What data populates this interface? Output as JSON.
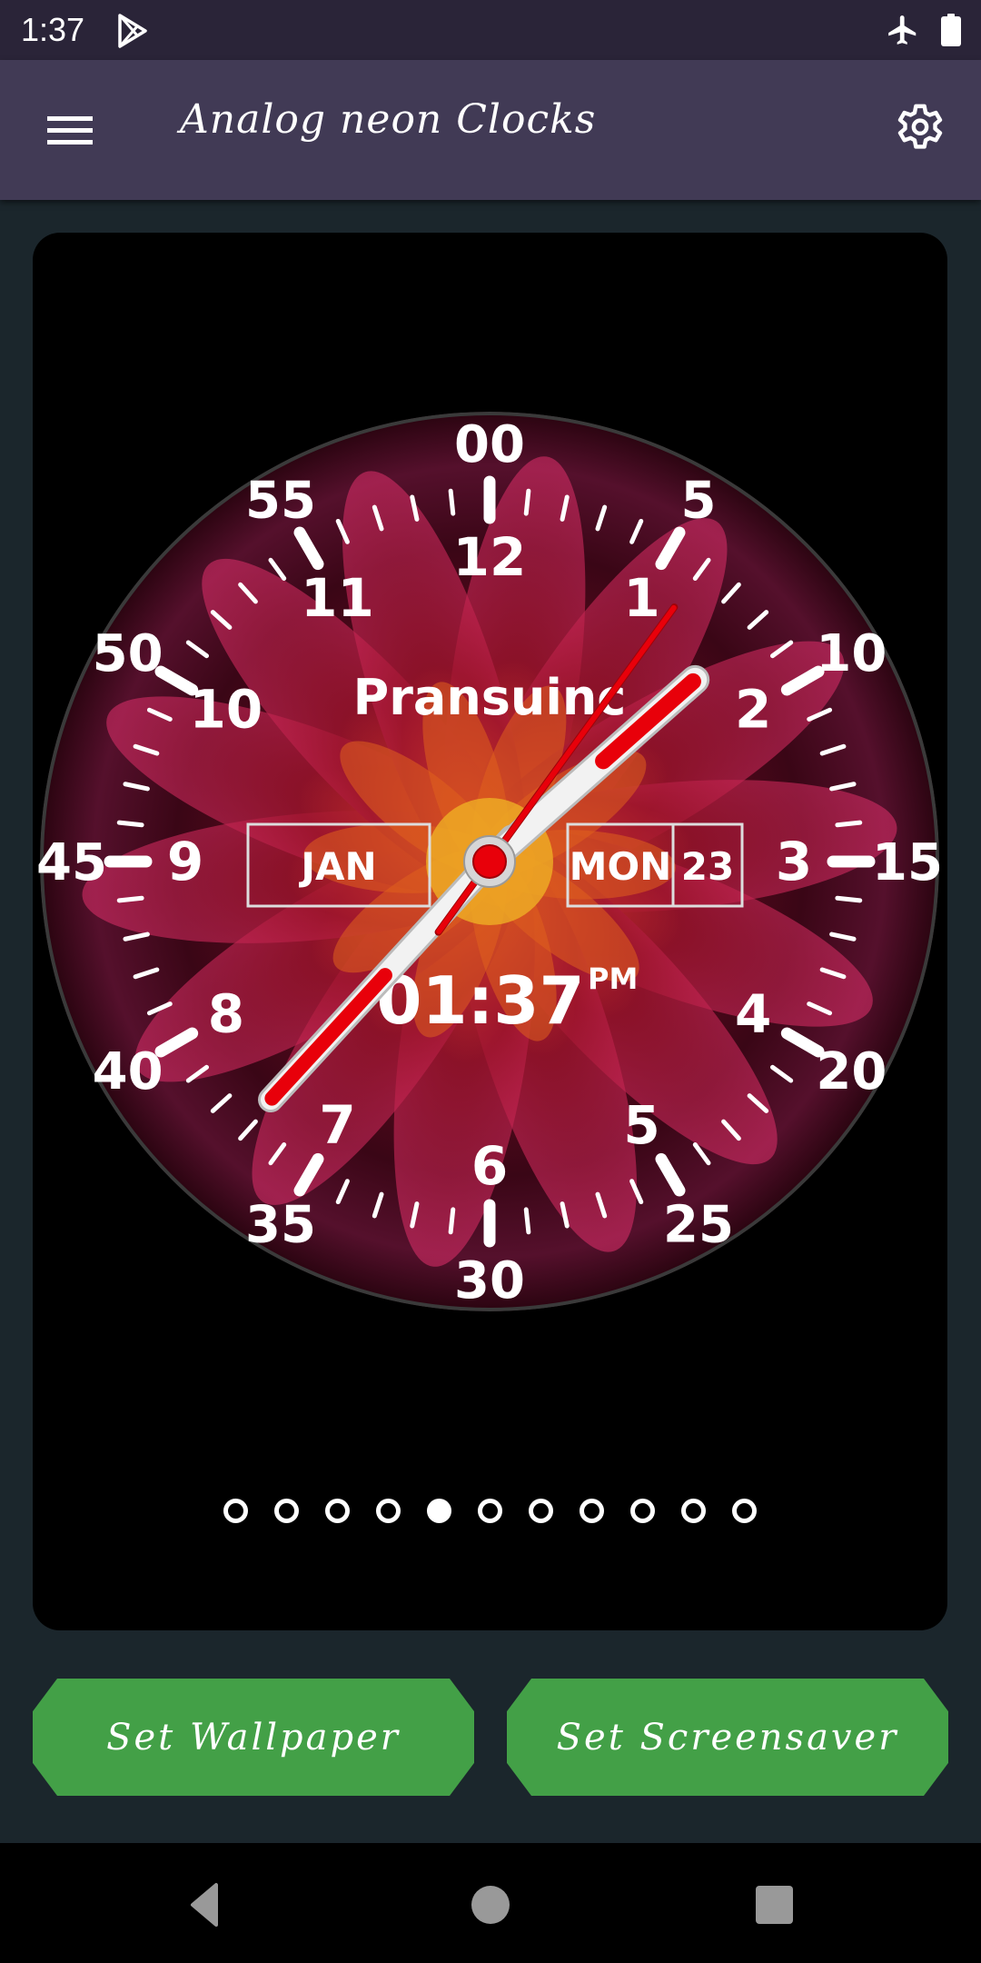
{
  "status_bar": {
    "time": "1:37",
    "icons": [
      "play-store-icon",
      "airplane-mode-icon",
      "battery-icon"
    ]
  },
  "toolbar": {
    "title": "Analog neon Clocks",
    "menu_icon": "hamburger-menu-icon",
    "settings_icon": "gear-icon"
  },
  "clock": {
    "brand_text": "Pransuinc",
    "month": "JAN",
    "weekday": "MON",
    "day": "23",
    "digital_time": "01:37",
    "ampm": "PM",
    "time": {
      "hour": 1,
      "minute": 37,
      "second": 6
    },
    "hour_labels": [
      "12",
      "1",
      "2",
      "3",
      "4",
      "5",
      "6",
      "7",
      "8",
      "9",
      "10",
      "11"
    ],
    "minute_labels": [
      "00",
      "5",
      "10",
      "15",
      "20",
      "25",
      "30",
      "35",
      "40",
      "45",
      "50",
      "55"
    ],
    "colors": {
      "hand_red": "#e8000a",
      "hand_white": "#f2f2f2",
      "label": "#ffffff"
    }
  },
  "pager": {
    "count": 11,
    "active_index": 4
  },
  "actions": {
    "set_wallpaper": "Set Wallpaper",
    "set_screensaver": "Set Screensaver",
    "button_color": "#43a047"
  },
  "nav_bar": {
    "back_icon": "back-triangle-icon",
    "home_icon": "home-circle-icon",
    "recents_icon": "recents-square-icon"
  }
}
